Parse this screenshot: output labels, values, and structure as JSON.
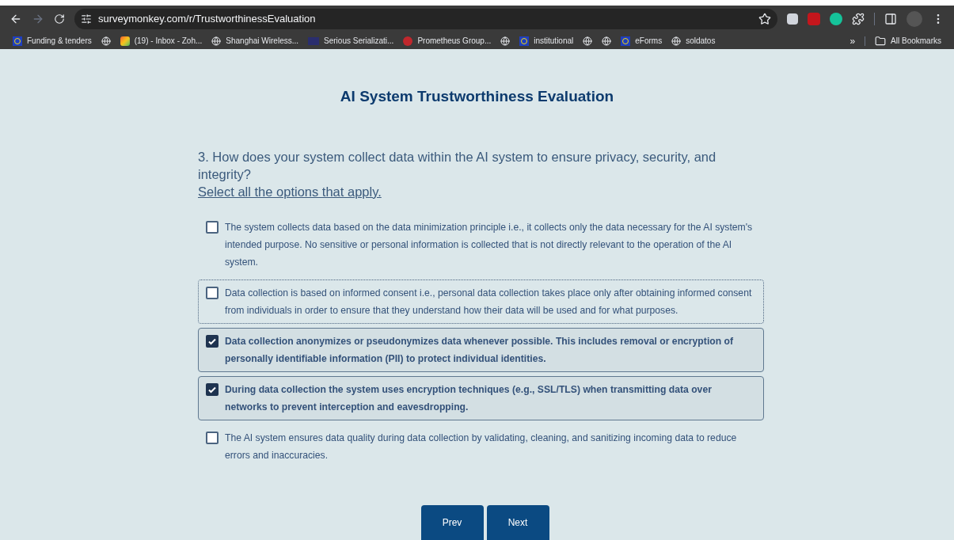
{
  "browser": {
    "url": "surveymonkey.com/r/TrustworthinessEvaluation",
    "bookmarks": [
      {
        "kind": "eu",
        "label": "Funding & tenders"
      },
      {
        "kind": "globe"
      },
      {
        "kind": "mail",
        "label": "(19) - Inbox - Zoh..."
      },
      {
        "kind": "globe",
        "label": "Shanghai Wireless..."
      },
      {
        "kind": "rf",
        "label": "Serious Serializati..."
      },
      {
        "kind": "prometheus",
        "label": "Prometheus Group..."
      },
      {
        "kind": "globe"
      },
      {
        "kind": "eu",
        "label": "institutional"
      },
      {
        "kind": "globe"
      },
      {
        "kind": "globe"
      },
      {
        "kind": "eu",
        "label": "eForms"
      },
      {
        "kind": "globe",
        "label": "soldatos"
      }
    ],
    "more": "»",
    "all_bookmarks": "All Bookmarks"
  },
  "survey": {
    "title": "AI System Trustworthiness Evaluation",
    "question": "3. How does your system collect data within the AI system to ensure privacy, security, and integrity?",
    "instruction": "Select all the options that apply.",
    "options": [
      {
        "text": "The system collects data based on the data minimization principle i.e., it collects only the data necessary for the AI system's intended purpose. No sensitive or personal information is collected that is not directly relevant to the operation of the AI system.",
        "checked": false,
        "focused": false
      },
      {
        "text": "Data collection is based on informed consent i.e., personal data collection takes place only after obtaining informed consent from individuals in order to ensure that they understand how their data will be used and for what purposes.",
        "checked": false,
        "focused": true
      },
      {
        "text": "Data collection anonymizes or pseudonymizes data whenever possible. This includes removal or encryption of personally identifiable information (PII) to protect individual identities.",
        "checked": true,
        "focused": false
      },
      {
        "text": "During data collection the system uses encryption techniques (e.g., SSL/TLS) when transmitting data over networks to prevent interception and eavesdropping.",
        "checked": true,
        "focused": false
      },
      {
        "text": "The AI system ensures data quality during data collection by validating, cleaning, and sanitizing incoming data to reduce errors and inaccuracies.",
        "checked": false,
        "focused": false
      }
    ],
    "buttons": [
      "Prev",
      "Next"
    ]
  }
}
